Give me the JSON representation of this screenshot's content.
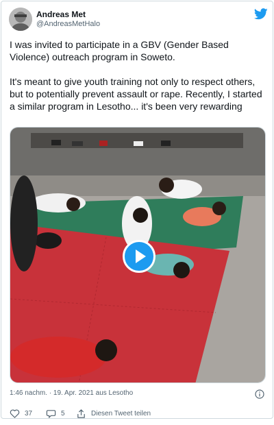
{
  "tweet": {
    "author_name": "Andreas Met",
    "author_handle": "@AndreasMetHalo",
    "paragraph_1": "I was invited to participate in a GBV (Gender Based Violence) outreach program in Soweto.",
    "paragraph_2": "It's meant to give youth training not only to respect others, but to potentially prevent assault or rape. Recently, I started a similar program in Lesotho... it's been very rewarding",
    "timestamp": "1:46 nachm. · 19. Apr. 2021 aus Lesotho",
    "likes": "37",
    "replies": "5",
    "share_label": "Diesen Tweet teilen"
  },
  "colors": {
    "accent": "#1d9bf0",
    "text": "#0f1419",
    "secondary": "#536471",
    "mat_red": "#c8323a",
    "mat_green": "#2f7d5b"
  },
  "icons": {
    "brand": "twitter-bird-icon",
    "play": "play-icon",
    "info": "info-icon",
    "like": "heart-icon",
    "reply": "reply-bubble-icon",
    "share": "share-icon"
  }
}
